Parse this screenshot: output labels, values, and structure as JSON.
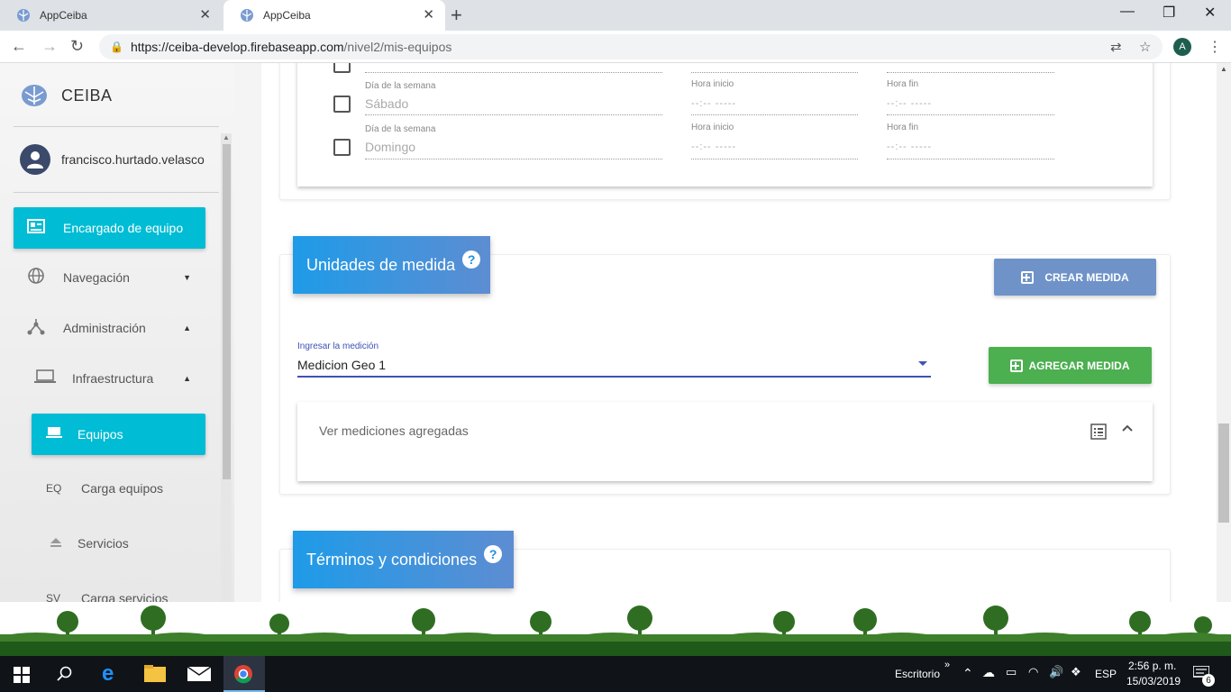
{
  "browser": {
    "tabs": [
      {
        "title": "AppCeiba"
      },
      {
        "title": "AppCeiba"
      }
    ],
    "url_domain": "https://ceiba-develop.firebaseapp.com",
    "url_path": "/nivel2/mis-equipos",
    "profile_initial": "A"
  },
  "sidebar": {
    "brand": "CEIBA",
    "user": "francisco.hurtado.velasco",
    "items": [
      {
        "label": "Encargado de equipo",
        "icon": "badge-icon"
      },
      {
        "label": "Navegación",
        "icon": "globe-icon"
      },
      {
        "label": "Administración",
        "icon": "hierarchy-icon"
      },
      {
        "label": "Infraestructura",
        "icon": "laptop-icon"
      },
      {
        "label": "Equipos",
        "icon": "laptop-icon"
      },
      {
        "label": "Carga equipos",
        "abbr": "EQ"
      },
      {
        "label": "Servicios",
        "icon": "eject-icon"
      },
      {
        "label": "Carga servicios",
        "abbr": "SV"
      }
    ]
  },
  "schedule": {
    "day_label": "Día de la semana",
    "start_label": "Hora inicio",
    "end_label": "Hora fin",
    "time_placeholder": "--:-- -----",
    "rows": [
      {
        "day": "Sábado"
      },
      {
        "day": "Domingo"
      }
    ]
  },
  "units": {
    "title": "Unidades de medida",
    "help": "?",
    "create_button": "CREAR MEDIDA",
    "select_label": "Ingresar la medición",
    "select_value": "Medicion Geo 1",
    "add_button": "AGREGAR MEDIDA",
    "added_panel": "Ver mediciones agregadas"
  },
  "terms": {
    "title": "Términos y condiciones",
    "help": "?"
  },
  "taskbar": {
    "desktop_label": "Escritorio",
    "lang": "ESP",
    "time": "2:56 p. m.",
    "date": "15/03/2019",
    "notif_count": "6"
  },
  "colors": {
    "accent_cyan": "#00bcd4",
    "header_blue": "#1e9be8",
    "create_btn": "#6f93c8",
    "add_btn": "#4caf50",
    "select_indigo": "#3f51b5"
  }
}
